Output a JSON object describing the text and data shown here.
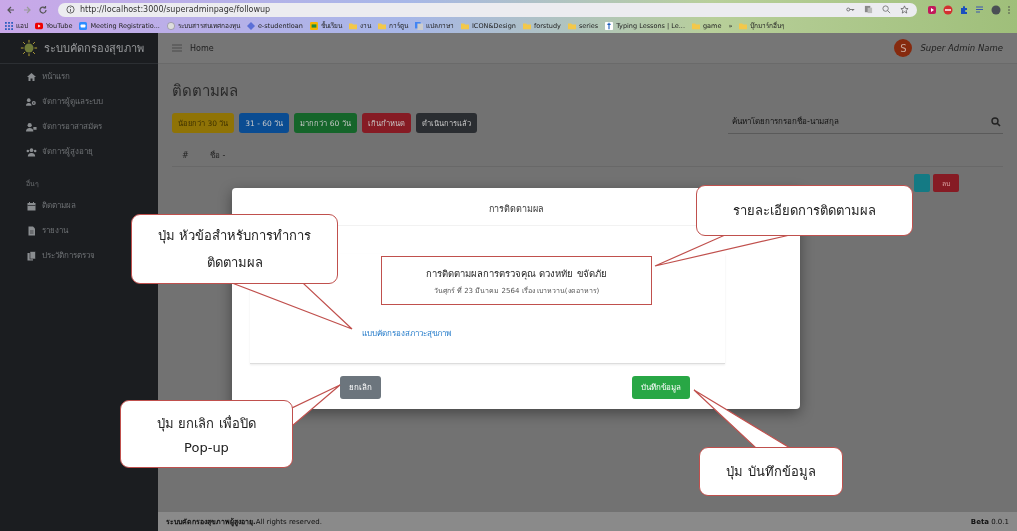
{
  "browser": {
    "url": "http://localhost:3000/superadminpage/followup",
    "bookmarks": [
      {
        "label": "แอป",
        "kind": "apps"
      },
      {
        "label": "YouTube",
        "kind": "video"
      },
      {
        "label": "Meeting Registratio...",
        "kind": "meeting"
      },
      {
        "label": "ระบบสารสนเทศกองทุน",
        "kind": "site"
      },
      {
        "label": "e-studentloan",
        "kind": "diamond"
      },
      {
        "label": "ชั้นเรียน",
        "kind": "classroom"
      },
      {
        "label": "งาน",
        "kind": "folder"
      },
      {
        "label": "การ์ตูน",
        "kind": "folder"
      },
      {
        "label": "แปลภาษา",
        "kind": "translate"
      },
      {
        "label": "ICON&Design",
        "kind": "folder"
      },
      {
        "label": "forstudy",
        "kind": "folder"
      },
      {
        "label": "series",
        "kind": "folder"
      },
      {
        "label": "Typing Lessons | Le...",
        "kind": "letter"
      },
      {
        "label": "game",
        "kind": "folder"
      },
      {
        "label": "»",
        "kind": "more"
      },
      {
        "label": "บุ๊กมาร์กอื่นๆ",
        "kind": "folder"
      }
    ]
  },
  "sidebar": {
    "brand": "ระบบคัดกรองสุขภาพ",
    "sections": [
      {
        "items": [
          {
            "label": "หน้าแรก",
            "kind": "home"
          },
          {
            "label": "จัดการผู้ดูแลระบบ",
            "kind": "admins"
          },
          {
            "label": "จัดการอาสาสมัคร",
            "kind": "volunteers"
          },
          {
            "label": "จัดการผู้สูงอายุ",
            "kind": "group"
          }
        ]
      },
      {
        "heading": "อื่นๆ",
        "items": [
          {
            "label": "ติดตามผล",
            "kind": "calendar"
          },
          {
            "label": "รายงาน",
            "kind": "file"
          },
          {
            "label": "ประวัติการตรวจ",
            "kind": "copy"
          }
        ]
      }
    ]
  },
  "navbar": {
    "breadcrumb": "Home",
    "avatar_letter": "S",
    "user": "Super Admin Name"
  },
  "page": {
    "title": "ติดตามผล",
    "filters": [
      {
        "label": "น้อยกว่า 30 วัน",
        "color": "#8f7306"
      },
      {
        "label": "31 - 60 วัน",
        "color": "#0a4c92"
      },
      {
        "label": "มากกว่า 60 วัน",
        "color": "#15652a"
      },
      {
        "label": "เกินกำหนด",
        "color": "#861b24"
      },
      {
        "label": "ดำเนินการแล้ว",
        "color": "#2a2d31"
      }
    ],
    "search": {
      "placeholder": "ค้นหาโดยการกรอกชื่อ-นามสกุล"
    },
    "table": {
      "columns": [
        "#",
        "ชื่อ -"
      ],
      "row_actions": [
        {
          "kind": "edit"
        },
        {
          "kind": "delete",
          "label": "ลบ"
        }
      ]
    }
  },
  "modal": {
    "title": "การติดตามผล",
    "detail_title": "การติดตามผลการตรวจคุณ ดวงหทัย ขจัดภัย",
    "detail_subtitle": "วันศุกร์ ที่ 23 มีนาคม 2564 เรื่อง เบาหวาน(งดอาหาร)",
    "link": "แบบคัดกรองสภาวะสุขภาพ",
    "cancel": "ยกเลิก",
    "save": "บันทึกข้อมูล"
  },
  "footer": {
    "text": "**ระบบคัดกรองสุขภาพผู้สูงอายุ.**All rights reserved.",
    "version": "**Beta** 0.0.1"
  },
  "callouts": [
    {
      "lines": [
        "ปุ่ม หัวข้อสำหรับการทำการ",
        "ติดตามผล"
      ]
    },
    {
      "lines": [
        "รายละเอียดการติดตามผล"
      ]
    },
    {
      "lines": [
        "ปุ่ม ยกเลิก เพื่อปิด",
        "Pop-up"
      ]
    },
    {
      "lines": [
        "ปุ่ม บันทึกข้อมูล"
      ]
    }
  ]
}
